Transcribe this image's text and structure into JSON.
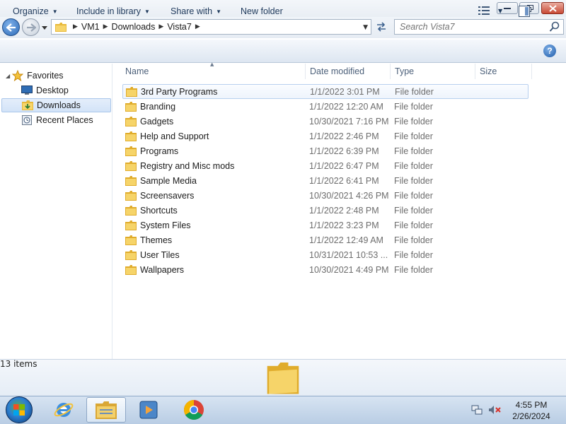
{
  "window": {
    "controls": {
      "minimize": "minimize",
      "maximize": "restore",
      "close": "close"
    }
  },
  "address": {
    "crumbs": [
      "VM1",
      "Downloads",
      "Vista7"
    ],
    "search_placeholder": "Search Vista7"
  },
  "toolbar": {
    "organize": "Organize",
    "include_in_library": "Include in library",
    "share_with": "Share with",
    "new_folder": "New folder"
  },
  "nav": {
    "favorites": "Favorites",
    "items": [
      {
        "label": "Desktop",
        "icon": "desktop-icon"
      },
      {
        "label": "Downloads",
        "icon": "downloads-folder-icon",
        "selected": true
      },
      {
        "label": "Recent Places",
        "icon": "recent-places-icon"
      }
    ]
  },
  "columns": {
    "name": "Name",
    "date_modified": "Date modified",
    "type": "Type",
    "size": "Size"
  },
  "files": [
    {
      "name": "3rd Party Programs",
      "date": "1/1/2022 3:01 PM",
      "type": "File folder"
    },
    {
      "name": "Branding",
      "date": "1/1/2022 12:20 AM",
      "type": "File folder"
    },
    {
      "name": "Gadgets",
      "date": "10/30/2021 7:16 PM",
      "type": "File folder"
    },
    {
      "name": "Help and Support",
      "date": "1/1/2022 2:46 PM",
      "type": "File folder"
    },
    {
      "name": "Programs",
      "date": "1/1/2022 6:39 PM",
      "type": "File folder"
    },
    {
      "name": "Registry and Misc mods",
      "date": "1/1/2022 6:47 PM",
      "type": "File folder"
    },
    {
      "name": "Sample Media",
      "date": "1/1/2022 6:41 PM",
      "type": "File folder"
    },
    {
      "name": "Screensavers",
      "date": "10/30/2021 4:26 PM",
      "type": "File folder"
    },
    {
      "name": "Shortcuts",
      "date": "1/1/2022 2:48 PM",
      "type": "File folder"
    },
    {
      "name": "System Files",
      "date": "1/1/2022 3:23 PM",
      "type": "File folder"
    },
    {
      "name": "Themes",
      "date": "1/1/2022 12:49 AM",
      "type": "File folder"
    },
    {
      "name": "User Tiles",
      "date": "10/31/2021 10:53 ...",
      "type": "File folder"
    },
    {
      "name": "Wallpapers",
      "date": "10/30/2021 4:49 PM",
      "type": "File folder"
    }
  ],
  "details": {
    "count": "13 items"
  },
  "taskbar": {
    "time": "4:55 PM",
    "date": "2/26/2024",
    "pinned": [
      "internet-explorer-icon",
      "windows-explorer-icon",
      "media-center-icon",
      "chrome-icon"
    ]
  },
  "colors": {
    "selection_border": "#a9c6ea",
    "toolbar_text": "#1e395b",
    "column_header_text": "#4c607a",
    "folder_yellow": "#f2c94c"
  }
}
